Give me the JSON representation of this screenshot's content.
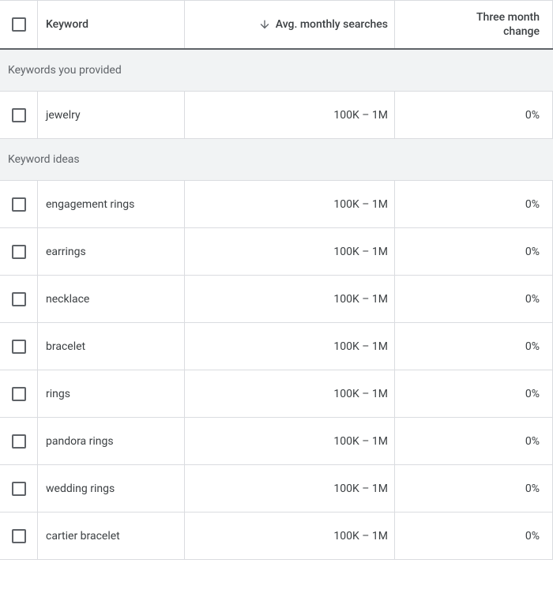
{
  "header": {
    "keyword_label": "Keyword",
    "searches_label": "Avg. monthly searches",
    "change_label_line1": "Three month",
    "change_label_line2": "change"
  },
  "sections": {
    "provided_label": "Keywords you provided",
    "ideas_label": "Keyword ideas"
  },
  "provided_keywords": [
    {
      "keyword": "jewelry",
      "searches": "100K – 1M",
      "change": "0%"
    }
  ],
  "keyword_ideas": [
    {
      "keyword": "engagement rings",
      "searches": "100K – 1M",
      "change": "0%"
    },
    {
      "keyword": "earrings",
      "searches": "100K – 1M",
      "change": "0%"
    },
    {
      "keyword": "necklace",
      "searches": "100K – 1M",
      "change": "0%"
    },
    {
      "keyword": "bracelet",
      "searches": "100K – 1M",
      "change": "0%"
    },
    {
      "keyword": "rings",
      "searches": "100K – 1M",
      "change": "0%"
    },
    {
      "keyword": "pandora rings",
      "searches": "100K – 1M",
      "change": "0%"
    },
    {
      "keyword": "wedding rings",
      "searches": "100K – 1M",
      "change": "0%"
    },
    {
      "keyword": "cartier bracelet",
      "searches": "100K – 1M",
      "change": "0%"
    }
  ]
}
